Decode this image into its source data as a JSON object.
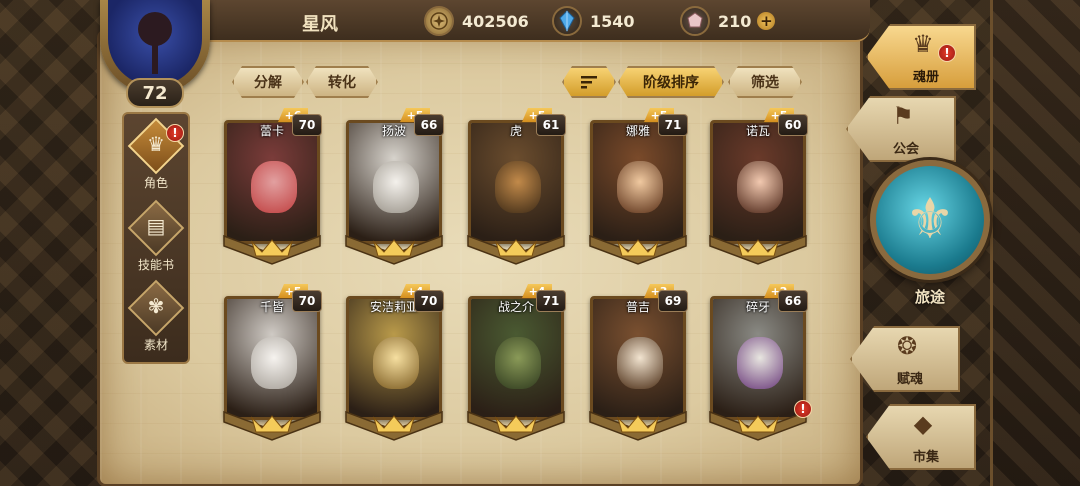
{
  "player": {
    "name": "星风",
    "level": "72"
  },
  "resources": {
    "gold": "402506",
    "gems": "1540",
    "crystals": "210",
    "add_symbol": "+"
  },
  "toolbar": {
    "decompose": "分解",
    "convert": "转化",
    "sort_icon": "sort-icon",
    "sort_by_tier": "阶级排序",
    "filter": "筛选"
  },
  "left_nav": [
    {
      "label": "角色",
      "icon": "character-icon",
      "active": true,
      "alert": true
    },
    {
      "label": "技能书",
      "icon": "skillbook-icon",
      "active": false,
      "alert": false
    },
    {
      "label": "素材",
      "icon": "material-icon",
      "active": false,
      "alert": false
    }
  ],
  "heroes": [
    {
      "name": "蕾卡",
      "level": "70",
      "plus": "+6",
      "alert": false
    },
    {
      "name": "扬波",
      "level": "66",
      "plus": "+5",
      "alert": false
    },
    {
      "name": "虎",
      "level": "61",
      "plus": "+5",
      "alert": false
    },
    {
      "name": "娜雅",
      "level": "71",
      "plus": "+5",
      "alert": false
    },
    {
      "name": "诺瓦",
      "level": "60",
      "plus": "+5",
      "alert": false
    },
    {
      "name": "千皆",
      "level": "70",
      "plus": "+5",
      "alert": false
    },
    {
      "name": "安洁莉亚",
      "level": "70",
      "plus": "+4",
      "alert": false
    },
    {
      "name": "战之介",
      "level": "71",
      "plus": "+4",
      "alert": false
    },
    {
      "name": "普吉",
      "level": "69",
      "plus": "+3",
      "alert": false
    },
    {
      "name": "碎牙",
      "level": "66",
      "plus": "+2",
      "alert": true
    }
  ],
  "right_nav": {
    "soulbook": "魂册",
    "guild": "公会",
    "journey": "旅途",
    "fusion": "赋魂",
    "market": "市集"
  },
  "alert_symbol": "!",
  "colors": {
    "accent": "#d39d2a",
    "alert": "#e33b2a",
    "parchment": "#dccaa0"
  }
}
